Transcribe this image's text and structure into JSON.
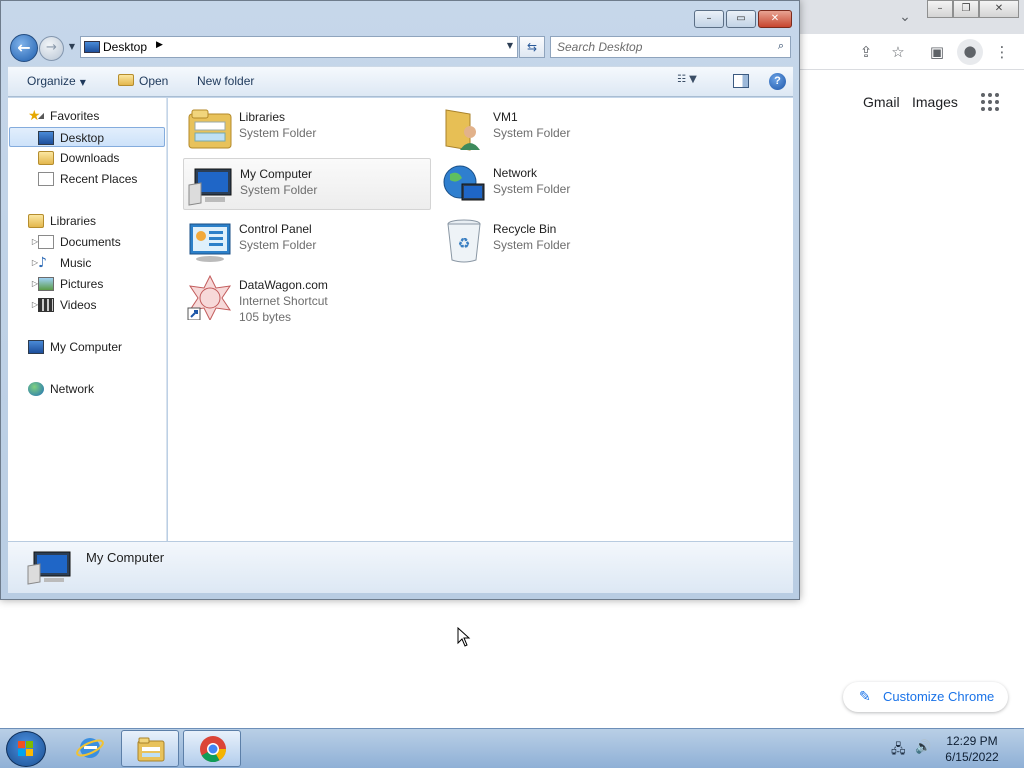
{
  "explorer": {
    "location": "Desktop",
    "search_placeholder": "Search Desktop",
    "commands": {
      "organize": "Organize",
      "open": "Open",
      "new_folder": "New folder"
    },
    "nav": {
      "favorites": {
        "label": "Favorites",
        "items": [
          "Desktop",
          "Downloads",
          "Recent Places"
        ]
      },
      "libraries": {
        "label": "Libraries",
        "items": [
          "Documents",
          "Music",
          "Pictures",
          "Videos"
        ]
      },
      "my_computer": "My Computer",
      "network": "Network"
    },
    "items": [
      {
        "name": "Libraries",
        "type": "System Folder",
        "icon": "libraries-icon"
      },
      {
        "name": "VM1",
        "type": "System Folder",
        "icon": "user-folder-icon"
      },
      {
        "name": "My Computer",
        "type": "System Folder",
        "icon": "computer-icon",
        "selected": true
      },
      {
        "name": "Network",
        "type": "System Folder",
        "icon": "network-icon"
      },
      {
        "name": "Control Panel",
        "type": "System Folder",
        "icon": "control-panel-icon"
      },
      {
        "name": "Recycle Bin",
        "type": "System Folder",
        "icon": "recycle-bin-icon"
      },
      {
        "name": "DataWagon.com",
        "type": "Internet Shortcut",
        "size": "105 bytes",
        "icon": "internet-shortcut-icon"
      }
    ],
    "details": {
      "name": "My Computer"
    }
  },
  "chrome": {
    "links": {
      "gmail": "Gmail",
      "images": "Images"
    },
    "customize": "Customize Chrome"
  },
  "taskbar": {
    "time": "12:29 PM",
    "date": "6/15/2022",
    "apps": [
      "internet-explorer-icon",
      "windows-explorer-icon",
      "chrome-icon"
    ]
  }
}
